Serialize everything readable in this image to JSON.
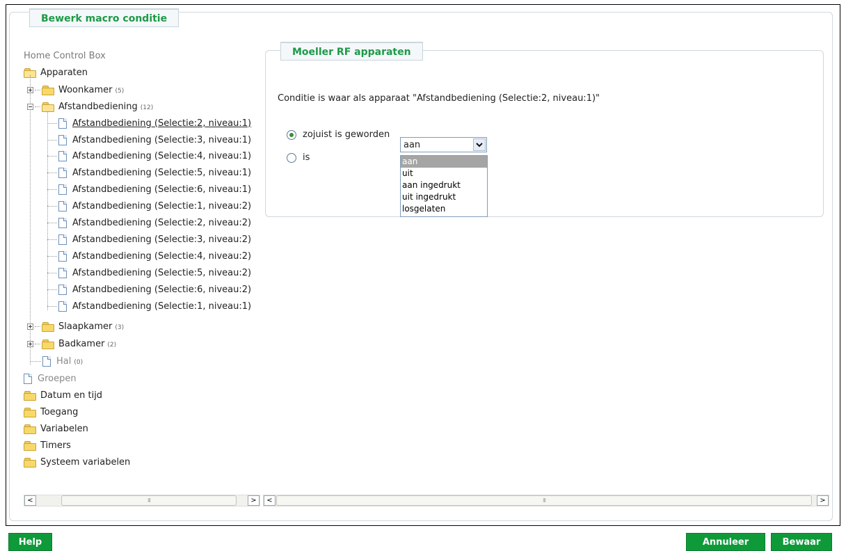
{
  "dialog": {
    "title": "Bewerk macro conditie"
  },
  "tree": {
    "root": "Home Control Box",
    "apparaten": "Apparaten",
    "woonkamer": {
      "label": "Woonkamer",
      "count": "(5)"
    },
    "afstandbediening": {
      "label": "Afstandbediening",
      "count": "(12)"
    },
    "devices": [
      "Afstandbediening (Selectie:2, niveau:1)",
      "Afstandbediening (Selectie:3, niveau:1)",
      "Afstandbediening (Selectie:4, niveau:1)",
      "Afstandbediening (Selectie:5, niveau:1)",
      "Afstandbediening (Selectie:6, niveau:1)",
      "Afstandbediening (Selectie:1, niveau:2)",
      "Afstandbediening (Selectie:2, niveau:2)",
      "Afstandbediening (Selectie:3, niveau:2)",
      "Afstandbediening (Selectie:4, niveau:2)",
      "Afstandbediening (Selectie:5, niveau:2)",
      "Afstandbediening (Selectie:6, niveau:2)",
      "Afstandbediening (Selectie:1, niveau:1)"
    ],
    "slaapkamer": {
      "label": "Slaapkamer",
      "count": "(3)"
    },
    "badkamer": {
      "label": "Badkamer",
      "count": "(2)"
    },
    "hal": {
      "label": "Hal",
      "count": "(0)"
    },
    "groepen": "Groepen",
    "datum": "Datum en tijd",
    "toegang": "Toegang",
    "variabelen": "Variabelen",
    "timers": "Timers",
    "systeem": "Systeem variabelen"
  },
  "panel": {
    "title": "Moeller RF apparaten",
    "condition": "Conditie is waar als apparaat \"Afstandbediening (Selectie:2, niveau:1)\"",
    "radio_became": "zojuist is geworden",
    "radio_is": "is",
    "select_value": "aan",
    "options": [
      "aan",
      "uit",
      "aan ingedrukt",
      "uit ingedrukt",
      "losgelaten"
    ]
  },
  "scroll": {
    "left": "<",
    "right": ">",
    "grip": "III"
  },
  "buttons": {
    "help": "Help",
    "cancel": "Annuleer",
    "save": "Bewaar"
  }
}
